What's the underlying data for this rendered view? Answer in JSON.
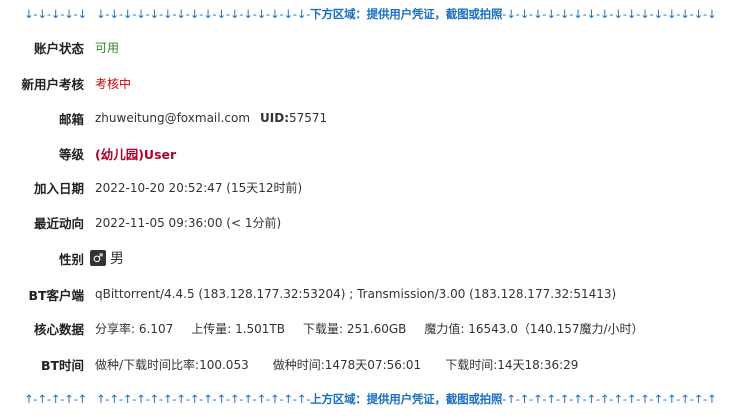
{
  "banner_top": {
    "left": "↓-↓-↓-↓-↓",
    "arrows_left": "↓-↓-↓-↓-↓-↓-↓-↓-↓-↓-↓-↓-↓-↓-↓-↓-",
    "text": "下方区域：提供用户凭证，截图或拍照",
    "arrows_right": "-↓-↓-↓-↓-↓-↓-↓-↓-↓-↓-↓-↓-↓-↓-↓-↓"
  },
  "banner_bottom": {
    "left": "↑-↑-↑-↑-↑",
    "arrows_left": "↑-↑-↑-↑-↑-↑-↑-↑-↑-↑-↑-↑-↑-↑-↑-↑-",
    "text": "上方区域：提供用户凭证，截图或拍照",
    "arrows_right": "-↑-↑-↑-↑-↑-↑-↑-↑-↑-↑-↑-↑-↑-↑-↑-↑"
  },
  "rows": {
    "status": {
      "label": "账户状态",
      "value": "可用"
    },
    "review": {
      "label": "新用户考核",
      "value": "考核中"
    },
    "email": {
      "label": "邮箱",
      "value": "zhuweitung@foxmail.com",
      "uid_label": "UID:",
      "uid": "57571"
    },
    "level": {
      "label": "等级",
      "value": "(幼儿园)User"
    },
    "joined": {
      "label": "加入日期",
      "value": "2022-10-20 20:52:47 (15天12时前)"
    },
    "last_seen": {
      "label": "最近动向",
      "value": "2022-11-05 09:36:00 (< 1分前)"
    },
    "gender": {
      "label": "性别",
      "icon": "male-icon",
      "glyph": "♂",
      "value": "男"
    },
    "bt_client": {
      "label": "BT客户端",
      "value": "qBittorrent/4.4.5 (183.128.177.32:53204) ; Transmission/3.00 (183.128.177.32:51413)"
    },
    "core": {
      "label": "核心数据",
      "ratio": "分享率: 6.107",
      "uploaded": "上传量: 1.501TB",
      "downloaded": "下载量: 251.60GB",
      "magic": "魔力值: 16543.0（140.157魔力/小时）"
    },
    "bt_time": {
      "label": "BT时间",
      "ratio": "做种/下载时间比率:100.053",
      "seed_time": "做种时间:1478天07:56:01",
      "leech_time": "下载时间:14天18:36:29"
    }
  }
}
